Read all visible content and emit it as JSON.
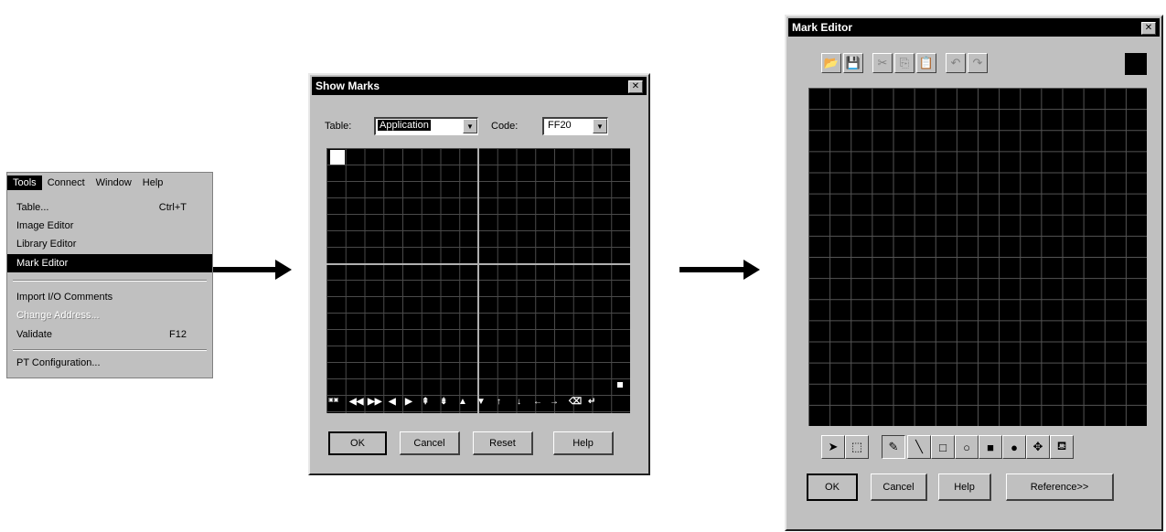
{
  "menu": {
    "bar": [
      "Tools",
      "Connect",
      "Window",
      "Help"
    ],
    "items": [
      {
        "label": "Table...",
        "shortcut": "Ctrl+T"
      },
      {
        "label": "Image Editor",
        "shortcut": ""
      },
      {
        "label": "Library Editor",
        "shortcut": ""
      },
      {
        "label": "Mark Editor",
        "shortcut": ""
      },
      {
        "label": "Import I/O Comments",
        "shortcut": ""
      },
      {
        "label": "Change Address...",
        "shortcut": ""
      },
      {
        "label": "Validate",
        "shortcut": "F12"
      },
      {
        "label": "PT Configuration...",
        "shortcut": ""
      }
    ]
  },
  "show_marks": {
    "title": "Show Marks",
    "close_glyph": "✕",
    "table_label": "Table:",
    "table_value": "Application",
    "code_label": "Code:",
    "code_value": "FF20",
    "symbols": [
      "◀◀",
      "▶▶",
      "◀",
      "▶",
      "⇞",
      "⇟",
      "▲",
      "▼",
      "↑",
      "↓",
      "←",
      "→",
      "⌫",
      "↵"
    ],
    "buttons": {
      "ok": "OK",
      "cancel": "Cancel",
      "reset": "Reset",
      "help": "Help"
    }
  },
  "mark_editor": {
    "title": "Mark Editor",
    "close_glyph": "✕",
    "buttons": {
      "ok": "OK",
      "cancel": "Cancel",
      "help": "Help",
      "reference": "Reference>>"
    }
  },
  "colors": {
    "dialog_bg": "#c0c0c0",
    "grid_bg": "#000000",
    "grid_line": "#5a5a5a",
    "highlight": "#000000"
  }
}
